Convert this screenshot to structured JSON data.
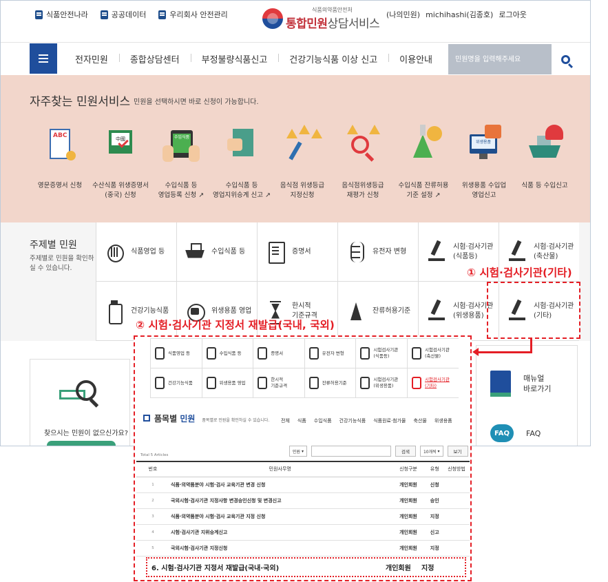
{
  "header": {
    "top_links": [
      "식품안전나라",
      "공공데이터",
      "우리회사 안전관리"
    ],
    "logo_sub": "식품의약품안전처",
    "logo_main_red": "통합민원",
    "logo_main_gray": "상담서비스",
    "user_links": [
      "(나의민원)",
      "michihashi(김종호)",
      "로그아웃"
    ]
  },
  "nav": {
    "items": [
      "전자민원",
      "종합상담센터",
      "부정불량식품신고",
      "건강기능식품 이상 신고",
      "이용안내"
    ],
    "search_placeholder": "민원명을 입력해주세요"
  },
  "frequent": {
    "title": "자주찾는 민원서비스",
    "desc": "민원을 선택하시면 바로 신청이 가능합니다.",
    "items": [
      {
        "l1": "영문증명서 신청",
        "l2": ""
      },
      {
        "l1": "수산식품 위생증명서",
        "l2": "(중국) 신청"
      },
      {
        "l1": "수입식품 등",
        "l2": "영업등록 신청 ↗"
      },
      {
        "l1": "수입식품 등",
        "l2": "영업지위승계 신고 ↗"
      },
      {
        "l1": "음식점 위생등급",
        "l2": "지정신청"
      },
      {
        "l1": "음식점위생등급",
        "l2": "재평가 신청"
      },
      {
        "l1": "수입식품 잔류허용",
        "l2": "기준 설정 ↗"
      },
      {
        "l1": "위생용품 수입업",
        "l2": "영업신고"
      },
      {
        "l1": "식품 등 수입신고",
        "l2": ""
      }
    ],
    "tablet_label": "수입식품",
    "monitor_label": "위생용품",
    "cert_letters": "ABC",
    "box_label": "中國"
  },
  "theme": {
    "title": "주제별 민원",
    "desc": "주제별로 민원을 확인하실 수 있습니다.",
    "cells": [
      {
        "l1": "식품영업 등",
        "l2": ""
      },
      {
        "l1": "수입식품 등",
        "l2": ""
      },
      {
        "l1": "증명서",
        "l2": ""
      },
      {
        "l1": "유전자 변형",
        "l2": ""
      },
      {
        "l1": "시험·검사기관",
        "l2": "(식품등)"
      },
      {
        "l1": "시험·검사기관",
        "l2": "(축산물)"
      },
      {
        "l1": "건강기능식품",
        "l2": ""
      },
      {
        "l1": "위생용품 영업",
        "l2": ""
      },
      {
        "l1": "한시적",
        "l2": "기준규격"
      },
      {
        "l1": "잔류허용기준",
        "l2": ""
      },
      {
        "l1": "시험·검사기관",
        "l2": "(위생용품)"
      },
      {
        "l1": "시험·검사기관",
        "l2": "(기타)"
      }
    ]
  },
  "lower": {
    "question": "찾으시는 민원이 없으신가요?",
    "manual": [
      "매뉴얼",
      "바로가기"
    ],
    "faq_icon": "FAQ",
    "faq_label": "FAQ"
  },
  "annotations": {
    "a1": "① 시험·검사기관(기타)",
    "a2": "② 시험·검사기관 지정서 재발급(국내, 국외)"
  },
  "inset": {
    "cells": [
      {
        "l1": "식품영업 등",
        "l2": ""
      },
      {
        "l1": "수입식품 등",
        "l2": ""
      },
      {
        "l1": "증명서",
        "l2": ""
      },
      {
        "l1": "유전자 변형",
        "l2": ""
      },
      {
        "l1": "시험검사기관",
        "l2": "(식품등)"
      },
      {
        "l1": "시험검사기관",
        "l2": "(축산물)"
      },
      {
        "l1": "건강기능식품",
        "l2": ""
      },
      {
        "l1": "위생용품 영업",
        "l2": ""
      },
      {
        "l1": "한시적",
        "l2": "기준규격"
      },
      {
        "l1": "잔류허용기준",
        "l2": ""
      },
      {
        "l1": "시험검사기관",
        "l2": "(위생용품)"
      },
      {
        "l1": "시험검사기관",
        "l2": "(기타)"
      }
    ],
    "title_a": "품목별 ",
    "title_b": "민원",
    "title_desc": "품목별로 민원을 확인하실 수 있습니다.",
    "tabs": [
      "전체",
      "식품",
      "수입식품",
      "건강기능식품",
      "식품원료·첨가물",
      "축산물",
      "위생용품"
    ],
    "select_label": "민원",
    "search_button": "검색",
    "per_page": "10개씩",
    "view_button": "보기",
    "total": "Total 5 Articles",
    "columns": [
      "번호",
      "민원사무명",
      "신청구분",
      "유형",
      "신청방법"
    ],
    "rows": [
      {
        "no": "1",
        "name": "식품·의약품분야 시험·검사 교육기관 변경 신청",
        "kind": "개인회원",
        "type": "신청"
      },
      {
        "no": "2",
        "name": "국외시험·검사기관 지정사항 변경승인신청 및 변경신고",
        "kind": "개인회원",
        "type": "승인"
      },
      {
        "no": "3",
        "name": "식품·의약품분야 시험·검사 교육기관 지정 신청",
        "kind": "개인회원",
        "type": "지정"
      },
      {
        "no": "4",
        "name": "시험·검사기관 지위승계신고",
        "kind": "개인회원",
        "type": "신고"
      },
      {
        "no": "5",
        "name": "국외시험·검사기관 지정신청",
        "kind": "개인회원",
        "type": "지정"
      }
    ],
    "added_row": {
      "name": "6. 시험·검사기관 지정서 재발급(국내·국외)",
      "kind": "개인회원",
      "type": "지정"
    }
  }
}
